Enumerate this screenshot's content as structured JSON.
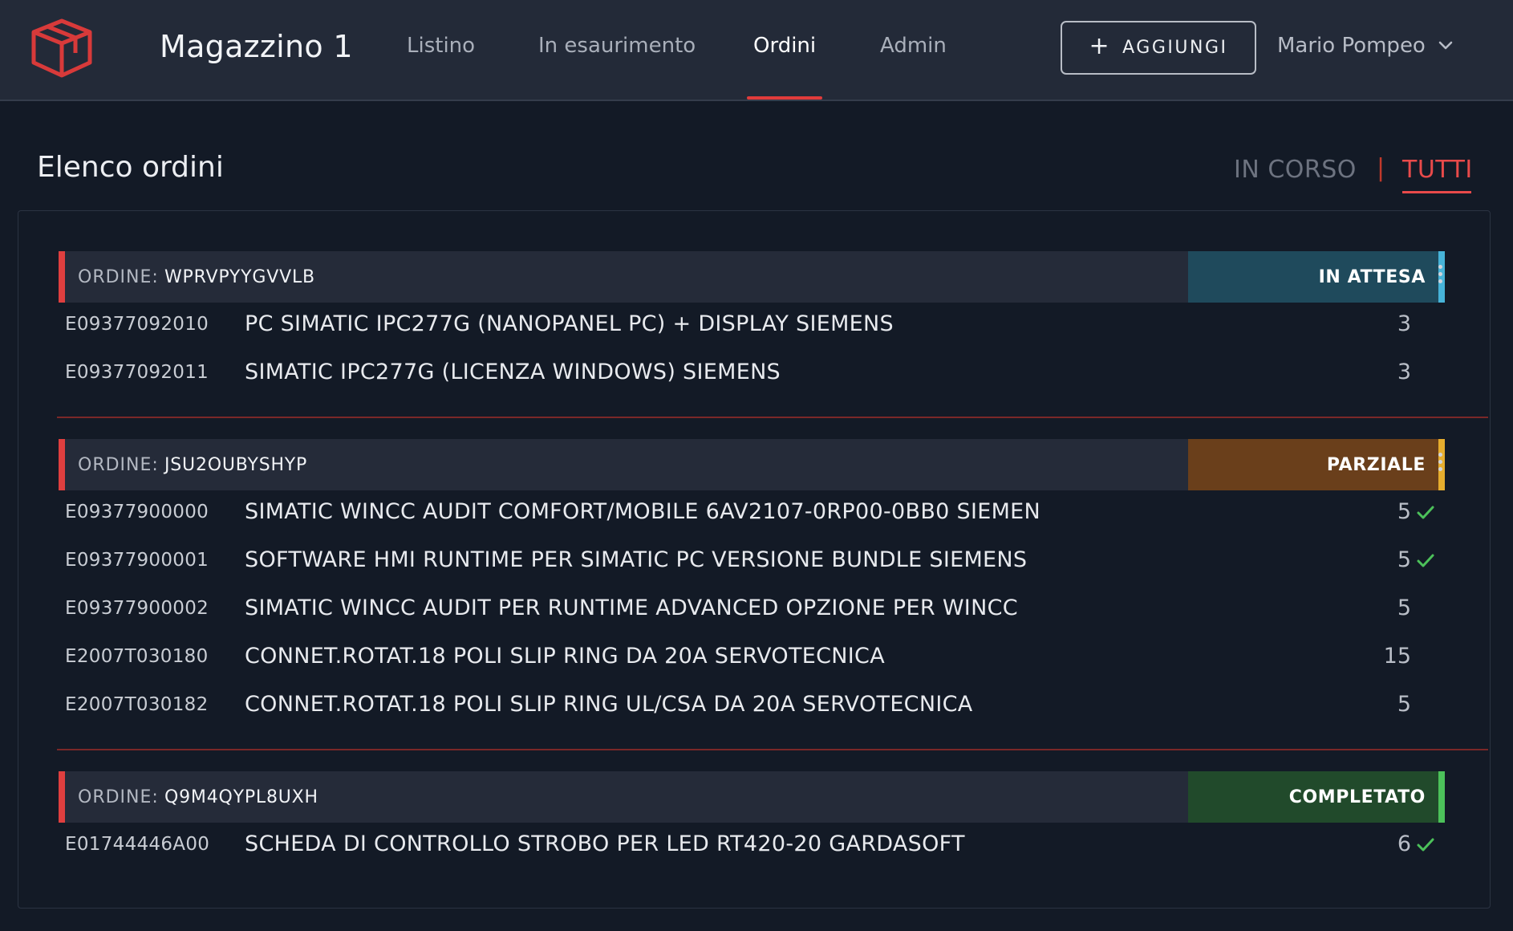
{
  "header": {
    "app_title": "Magazzino 1",
    "nav": [
      {
        "label": "Listino",
        "active": false
      },
      {
        "label": "In esaurimento",
        "active": false
      },
      {
        "label": "Ordini",
        "active": true
      },
      {
        "label": "Admin",
        "active": false
      }
    ],
    "add_button_label": "AGGIUNGI",
    "user_name": "Mario Pompeo",
    "logo_icon": "box-icon",
    "accent_color": "#e03b3b"
  },
  "page": {
    "title": "Elenco ordini",
    "filters": {
      "in_progress": "IN CORSO",
      "separator": "|",
      "all": "TUTTI",
      "selected": "TUTTI"
    }
  },
  "orders": [
    {
      "label": "ORDINE:",
      "id": "WPRVPYYGVVLB",
      "status": "IN ATTESA",
      "status_bg": "#1f4a5c",
      "status_accent": "#47b3d8",
      "items": [
        {
          "code": "E09377092010",
          "description": "PC SIMATIC IPC277G (NANOPANEL PC) + DISPLAY SIEMENS",
          "qty": "3",
          "checked": false
        },
        {
          "code": "E09377092011",
          "description": "SIMATIC IPC277G (LICENZA WINDOWS) SIEMENS",
          "qty": "3",
          "checked": false
        }
      ]
    },
    {
      "label": "ORDINE:",
      "id": "JSU2OUBYSHYP",
      "status": "PARZIALE",
      "status_bg": "#6a3f1b",
      "status_accent": "#e6ad2e",
      "items": [
        {
          "code": "E09377900000",
          "description": "SIMATIC WINCC AUDIT COMFORT/MOBILE 6AV2107-0RP00-0BB0 SIEMEN",
          "qty": "5",
          "checked": true
        },
        {
          "code": "E09377900001",
          "description": "SOFTWARE HMI RUNTIME PER SIMATIC PC VERSIONE BUNDLE SIEMENS",
          "qty": "5",
          "checked": true
        },
        {
          "code": "E09377900002",
          "description": "SIMATIC WINCC AUDIT PER RUNTIME ADVANCED OPZIONE PER WINCC",
          "qty": "5",
          "checked": false
        },
        {
          "code": "E2007T030180",
          "description": "CONNET.ROTAT.18 POLI SLIP RING DA 20A SERVOTECNICA",
          "qty": "15",
          "checked": false
        },
        {
          "code": "E2007T030182",
          "description": "CONNET.ROTAT.18 POLI SLIP RING UL/CSA DA 20A SERVOTECNICA",
          "qty": "5",
          "checked": false
        }
      ]
    },
    {
      "label": "ORDINE:",
      "id": "Q9M4QYPL8UXH",
      "status": "COMPLETATO",
      "status_bg": "#214a2b",
      "status_accent": "#4cc15a",
      "items": [
        {
          "code": "E01744446A00",
          "description": "SCHEDA DI CONTROLLO STROBO PER LED RT420-20 GARDASOFT",
          "qty": "6",
          "checked": true
        }
      ]
    }
  ]
}
